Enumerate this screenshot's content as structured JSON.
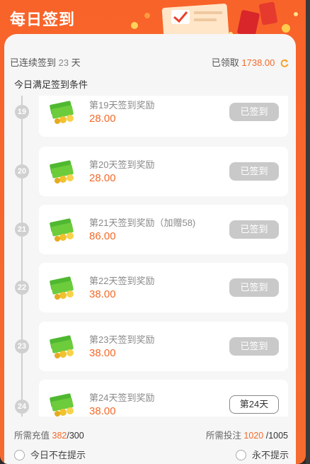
{
  "title": "每日签到",
  "stats": {
    "streak_prefix": "已连续签到",
    "streak_days": "23",
    "streak_unit": "天",
    "claimed_label": "已领取",
    "claimed_amount": "1738.00"
  },
  "condition_text": "今日满足签到条件",
  "rewards": [
    {
      "day": "19",
      "name": "第19天签到奖励",
      "amount": "28.00",
      "button": "已签到",
      "state": "done"
    },
    {
      "day": "20",
      "name": "第20天签到奖励",
      "amount": "28.00",
      "button": "已签到",
      "state": "done"
    },
    {
      "day": "21",
      "name": "第21天签到奖励（加赠58)",
      "amount": "86.00",
      "button": "已签到",
      "state": "done"
    },
    {
      "day": "22",
      "name": "第22天签到奖励",
      "amount": "38.00",
      "button": "已签到",
      "state": "done"
    },
    {
      "day": "23",
      "name": "第23天签到奖励",
      "amount": "38.00",
      "button": "已签到",
      "state": "done"
    },
    {
      "day": "24",
      "name": "第24天签到奖励",
      "amount": "38.00",
      "button": "第24天",
      "state": "pending"
    }
  ],
  "footer": {
    "recharge_label": "所需充值",
    "recharge_value": "382",
    "recharge_total": "/300",
    "bet_label": "所需投注",
    "bet_value": "1020",
    "bet_total": "/1005",
    "option_today": "今日不在提示",
    "option_never": "永不提示"
  },
  "colors": {
    "accent": "#f36a2a",
    "header_bg": "#f8632a",
    "done_button": "#c9c9c9"
  }
}
